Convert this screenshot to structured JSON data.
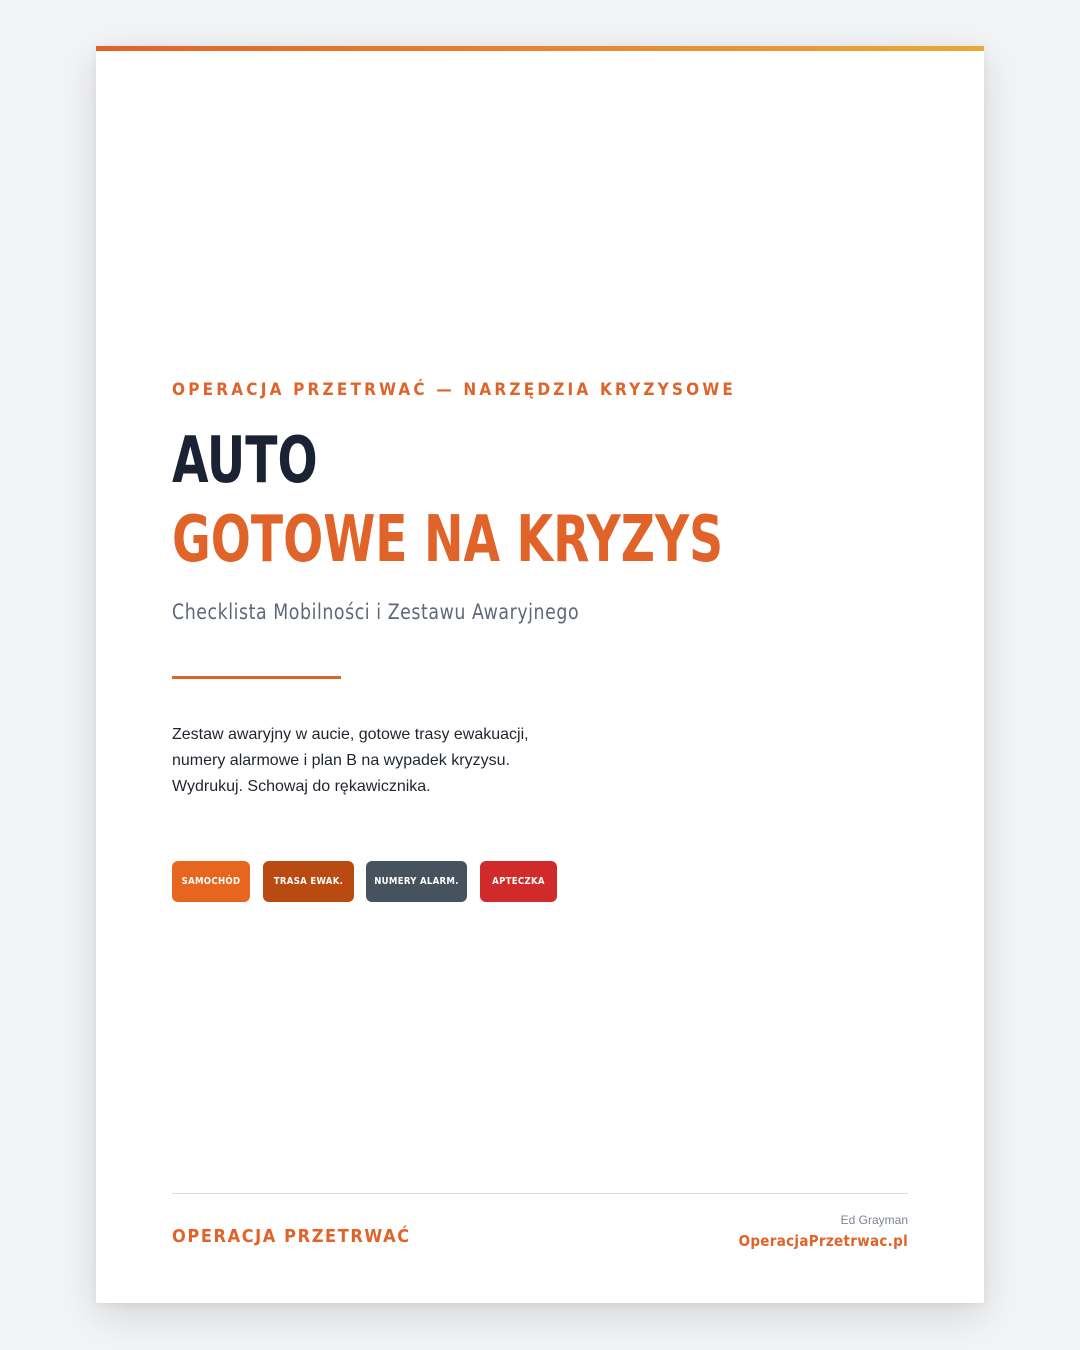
{
  "header": {
    "kicker": "OPERACJA PRZETRWAĆ — NARZĘDZIA KRYZYSOWE",
    "title_line_1": "AUTO",
    "title_line_2": "GOTOWE NA KRYZYS",
    "subtitle": "Checklista Mobilności i Zestawu Awaryjnego"
  },
  "description": {
    "lines": [
      "Zestaw awaryjny w aucie, gotowe trasy ewakuacji,",
      "numery alarmowe i plan B na wypadek kryzysu.",
      "Wydrukuj. Schowaj do rękawicznika."
    ]
  },
  "tags": [
    {
      "label": "SAMOCHÓD",
      "color": "#e8651f"
    },
    {
      "label": "TRASA EWAK.",
      "color": "#b84a12"
    },
    {
      "label": "NUMERY ALARM.",
      "color": "#46535f"
    },
    {
      "label": "APTECZKA",
      "color": "#d02a2a"
    }
  ],
  "footer": {
    "brand": "OPERACJA PRZETRWAĆ",
    "author": "Ed Grayman",
    "website": "OperacjaPrzetrwac.pl"
  },
  "colors": {
    "accent": "#e0632a",
    "accent_end": "#eba838",
    "title_dark": "#1a2233",
    "background": "#f3f4f6"
  }
}
